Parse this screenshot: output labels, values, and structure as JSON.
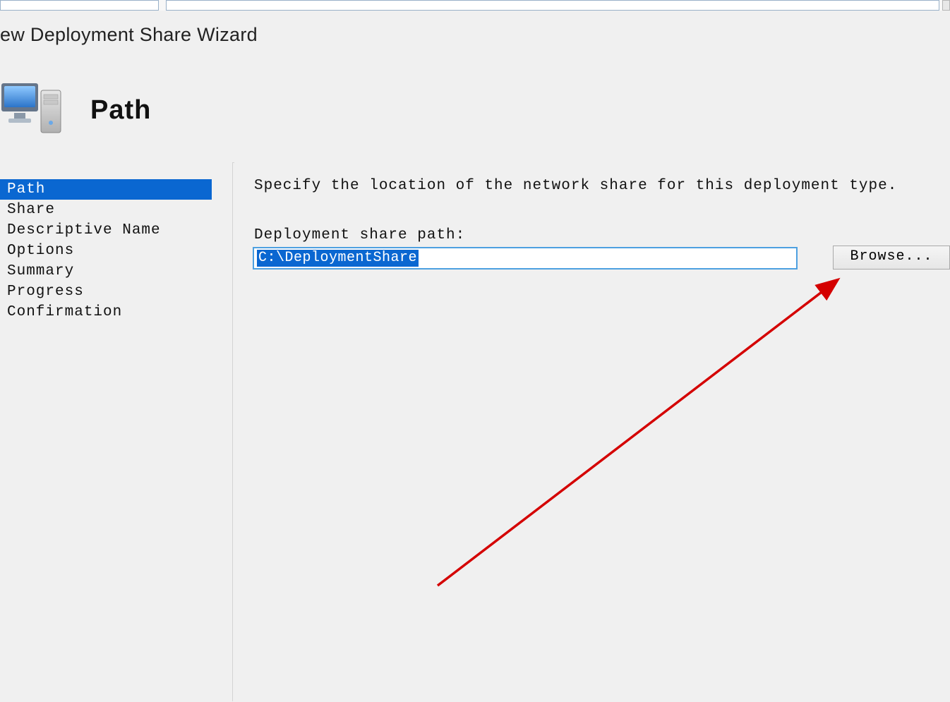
{
  "wizard": {
    "title": "ew Deployment Share Wizard",
    "page_heading": "Path"
  },
  "sidebar": {
    "items": [
      {
        "label": "Path",
        "selected": true
      },
      {
        "label": "Share",
        "selected": false
      },
      {
        "label": "Descriptive Name",
        "selected": false
      },
      {
        "label": "Options",
        "selected": false
      },
      {
        "label": "Summary",
        "selected": false
      },
      {
        "label": "Progress",
        "selected": false
      },
      {
        "label": "Confirmation",
        "selected": false
      }
    ]
  },
  "main": {
    "instruction": "Specify the location of the network share for this deployment type.",
    "path_label": "Deployment share path:",
    "path_value": "C:\\DeploymentShare",
    "browse_label": "Browse..."
  },
  "annotation": {
    "arrow_color": "#d40000"
  }
}
